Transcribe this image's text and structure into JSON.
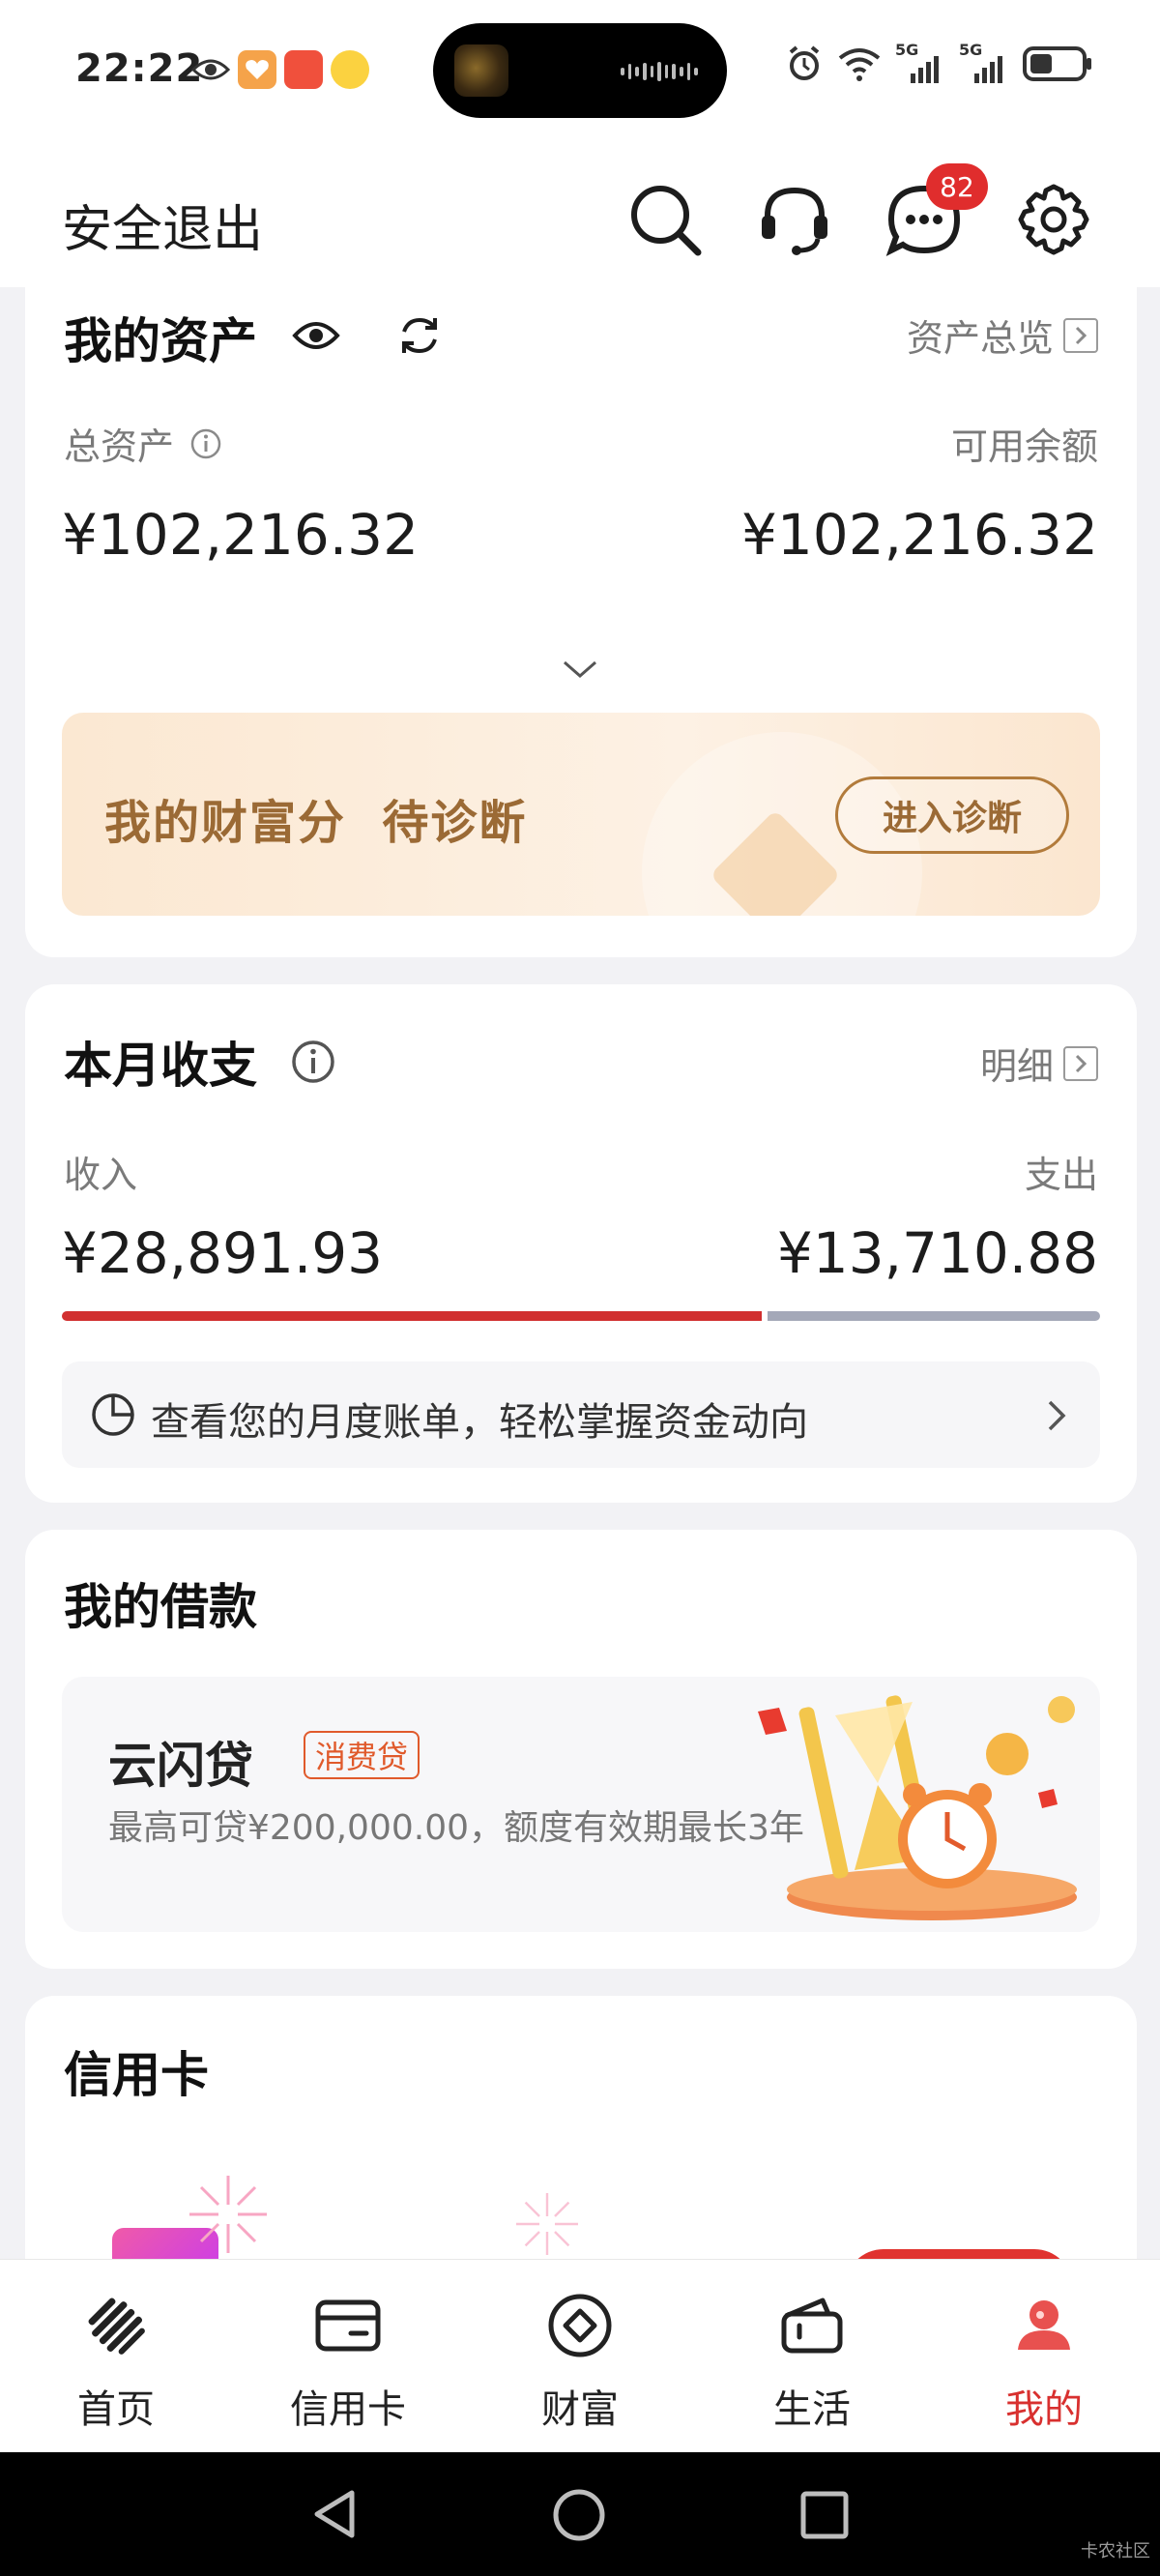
{
  "status_bar": {
    "time": "22:22",
    "battery_icon": "battery-icon",
    "signal_labels": [
      "5G",
      "5G"
    ]
  },
  "header": {
    "logout_label": "安全退出",
    "message_badge": "82",
    "icons": [
      "search-icon",
      "headset-icon",
      "message-icon",
      "gear-icon"
    ]
  },
  "assets": {
    "title": "我的资产",
    "overview_link": "资产总览",
    "total_label": "总资产",
    "total_value": "¥102,216.32",
    "available_label": "可用余额",
    "available_value": "¥102,216.32",
    "wealth_score_text": "我的财富分  待诊断",
    "wealth_button": "进入诊断"
  },
  "monthly": {
    "title": "本月收支",
    "detail_link": "明细",
    "income_label": "收入",
    "income_value": "¥28,891.93",
    "expense_label": "支出",
    "expense_value": "¥13,710.88",
    "income_ratio": 0.678,
    "bill_text": "查看您的月度账单，轻松掌握资金动向",
    "colors": {
      "income": "#d12f2f",
      "expense": "#a4a8b8"
    }
  },
  "loan": {
    "title": "我的借款",
    "product_name": "云闪贷",
    "product_tag": "消费贷",
    "description": "最高可贷¥200,000.00，额度有效期最长3年"
  },
  "credit_card": {
    "title": "信用卡"
  },
  "bottom_nav": {
    "items": [
      {
        "label": "首页",
        "icon": "home-logo-icon"
      },
      {
        "label": "信用卡",
        "icon": "card-icon"
      },
      {
        "label": "财富",
        "icon": "wealth-diamond-icon"
      },
      {
        "label": "生活",
        "icon": "wallet-icon"
      },
      {
        "label": "我的",
        "icon": "profile-icon",
        "active": true
      }
    ],
    "active_color": "#d8302f"
  },
  "watermark": "卡农社区"
}
